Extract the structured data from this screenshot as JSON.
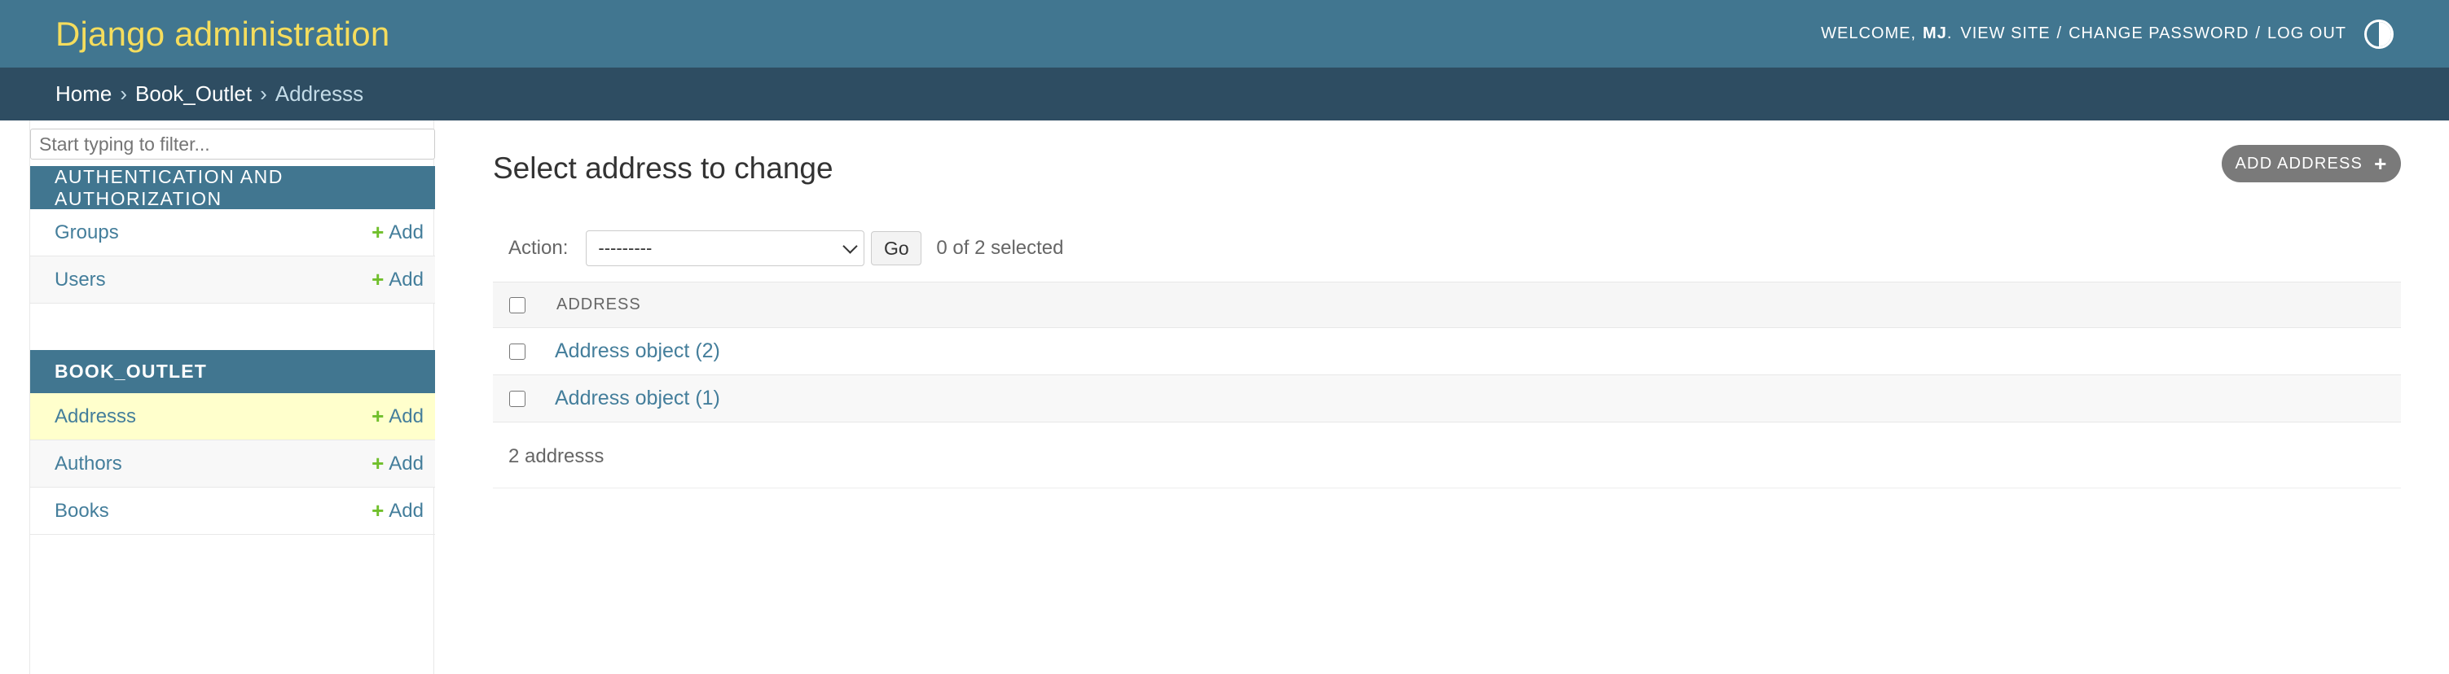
{
  "header": {
    "site_name": "Django administration",
    "welcome": "Welcome,",
    "user": "MJ",
    "view_site": "View site",
    "change_password": "Change password",
    "log_out": "Log out",
    "separator": "/",
    "theme_icon": "theme-toggle-icon"
  },
  "breadcrumbs": {
    "home": "Home",
    "app": "Book_Outlet",
    "current": "Addresss",
    "separator": "›"
  },
  "sidebar": {
    "filter_placeholder": "Start typing to filter...",
    "modules": [
      {
        "caption": "Authentication and Authorization",
        "models": [
          {
            "name": "Groups",
            "add": "Add"
          },
          {
            "name": "Users",
            "add": "Add"
          }
        ]
      },
      {
        "caption": "Book_Outlet",
        "models": [
          {
            "name": "Addresss",
            "add": "Add",
            "current": true
          },
          {
            "name": "Authors",
            "add": "Add"
          },
          {
            "name": "Books",
            "add": "Add"
          }
        ]
      }
    ],
    "add_icon": "plus-icon"
  },
  "content": {
    "title": "Select address to change",
    "add_button": "Add address",
    "actions": {
      "label": "Action:",
      "selected_option": "---------",
      "go": "Go",
      "selected_count": "0 of 2 selected"
    },
    "table": {
      "column": "Address",
      "rows": [
        "Address object (2)",
        "Address object (1)"
      ]
    },
    "paginator": "2 addresss"
  },
  "colors": {
    "header_bg": "#417690",
    "site_name": "#f5dd5d",
    "breadcrumbs_bg": "#2e4d62",
    "link": "#447e9b",
    "add_plus": "#70bf2b",
    "current_row": "#ffffcc"
  }
}
